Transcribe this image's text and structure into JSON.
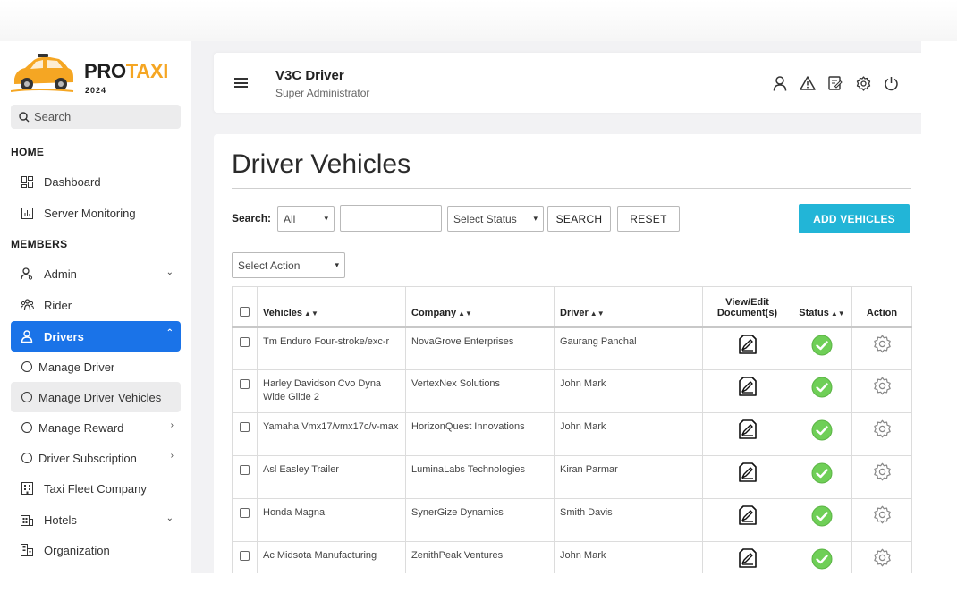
{
  "brand": {
    "name_part1": "PRO",
    "name_part2": "TAXI",
    "year": "2024",
    "accent_color": "#f5a623"
  },
  "sidebar": {
    "search_placeholder": "Search",
    "section_home": "HOME",
    "section_members": "MEMBERS",
    "items": [
      {
        "label": "Dashboard",
        "icon": "dashboard-icon"
      },
      {
        "label": "Server Monitoring",
        "icon": "chart-icon"
      },
      {
        "label": "Admin",
        "icon": "admin-icon"
      },
      {
        "label": "Rider",
        "icon": "rider-icon"
      },
      {
        "label": "Drivers",
        "icon": "driver-icon"
      },
      {
        "label": "Manage Driver"
      },
      {
        "label": "Manage Driver Vehicles"
      },
      {
        "label": "Manage Reward"
      },
      {
        "label": "Driver Subscription"
      },
      {
        "label": "Taxi Fleet Company",
        "icon": "building-icon"
      },
      {
        "label": "Hotels",
        "icon": "hotel-icon"
      },
      {
        "label": "Organization",
        "icon": "organization-icon"
      }
    ],
    "active_color": "#1a73e8"
  },
  "header": {
    "title": "V3C Driver",
    "subtitle": "Super Administrator"
  },
  "main": {
    "title": "Driver Vehicles",
    "search_label": "Search:",
    "filter_all": "All",
    "status_placeholder": "Select Status",
    "search_button": "SEARCH",
    "reset_button": "RESET",
    "add_button": "ADD VEHICLES",
    "add_button_color": "#22b5d7",
    "action_select": "Select Action",
    "columns": {
      "vehicles": "Vehicles",
      "company": "Company",
      "driver": "Driver",
      "documents_line1": "View/Edit",
      "documents_line2": "Document(s)",
      "status": "Status",
      "action": "Action"
    },
    "rows": [
      {
        "vehicle": "Tm Enduro Four-stroke/exc-r",
        "company": "NovaGrove Enterprises",
        "driver": "Gaurang Panchal"
      },
      {
        "vehicle": "Harley Davidson Cvo Dyna Wide Glide 2",
        "company": "VertexNex Solutions",
        "driver": "John Mark"
      },
      {
        "vehicle": "Yamaha Vmx17/vmx17c/v-max",
        "company": "HorizonQuest Innovations",
        "driver": "John Mark"
      },
      {
        "vehicle": "Asl Easley Trailer",
        "company": "LuminaLabs Technologies",
        "driver": "Kiran Parmar"
      },
      {
        "vehicle": "Honda Magna",
        "company": "SynerGize Dynamics",
        "driver": "Smith Davis"
      },
      {
        "vehicle": "Ac Midsota Manufacturing",
        "company": "ZenithPeak Ventures",
        "driver": "John Mark"
      }
    ],
    "status_color": "#6fcf57"
  }
}
